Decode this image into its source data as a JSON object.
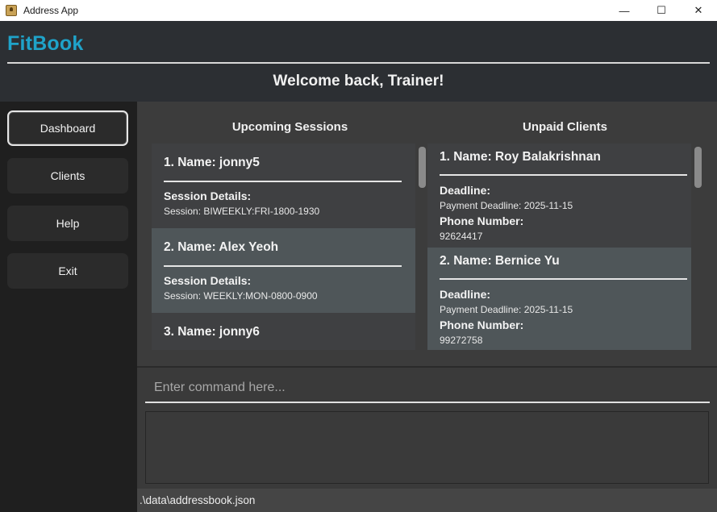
{
  "window": {
    "title": "Address App",
    "controls": {
      "minimize": "—",
      "maximize": "☐",
      "close": "✕"
    }
  },
  "header": {
    "brand": "FitBook",
    "welcome": "Welcome back, Trainer!"
  },
  "sidebar": {
    "items": [
      {
        "label": "Dashboard",
        "active": true
      },
      {
        "label": "Clients"
      },
      {
        "label": "Help"
      },
      {
        "label": "Exit"
      }
    ]
  },
  "sessions": {
    "title": "Upcoming Sessions",
    "cards": [
      {
        "name": "1.  Name: jonny5",
        "details_label": "Session Details:",
        "details": "Session: BIWEEKLY:FRI-1800-1930"
      },
      {
        "name": "2.  Name: Alex Yeoh",
        "details_label": "Session Details:",
        "details": "Session: WEEKLY:MON-0800-0900"
      },
      {
        "name": "3.  Name: jonny6"
      }
    ]
  },
  "unpaid": {
    "title": "Unpaid Clients",
    "cards": [
      {
        "name": "1.  Name: Roy Balakrishnan",
        "deadline_label": "Deadline:",
        "deadline": "Payment Deadline: 2025-11-15",
        "phone_label": "Phone Number:",
        "phone": "92624417"
      },
      {
        "name": "2.  Name: Bernice Yu",
        "deadline_label": "Deadline:",
        "deadline": "Payment Deadline: 2025-11-15",
        "phone_label": "Phone Number:",
        "phone": "99272758"
      }
    ]
  },
  "command": {
    "placeholder": "Enter command here...",
    "value": ""
  },
  "result": {
    "text": ""
  },
  "status": {
    "path": ".\\data\\addressbook.json"
  }
}
